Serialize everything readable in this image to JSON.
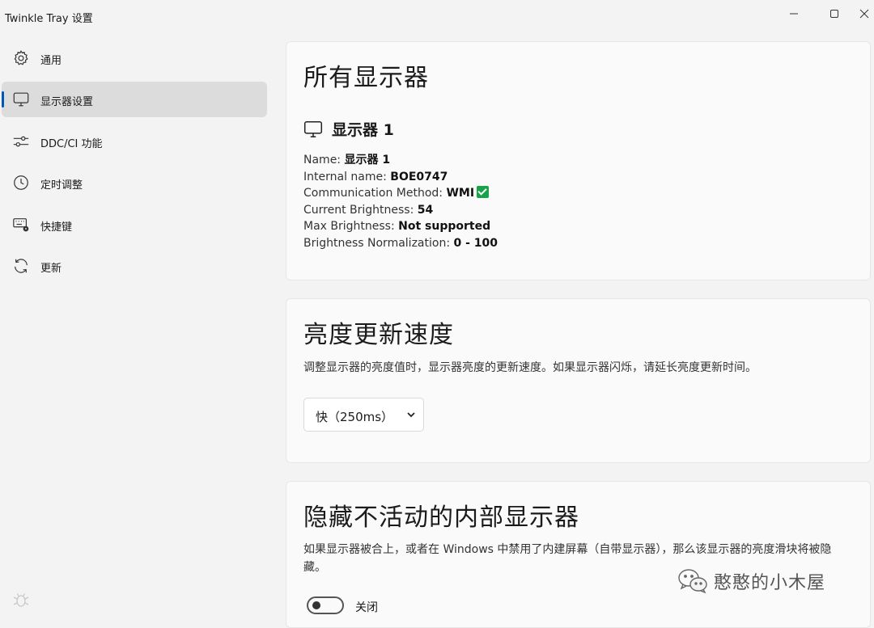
{
  "window": {
    "title": "Twinkle Tray 设置"
  },
  "sidebar": {
    "items": [
      {
        "label": "通用",
        "icon": "gear-icon"
      },
      {
        "label": "显示器设置",
        "icon": "monitor-icon",
        "active": true
      },
      {
        "label": "DDC/CI 功能",
        "icon": "sliders-icon"
      },
      {
        "label": "定时调整",
        "icon": "clock-icon"
      },
      {
        "label": "快捷键",
        "icon": "keyboard-icon"
      },
      {
        "label": "更新",
        "icon": "refresh-icon"
      }
    ],
    "footer_icon": "bug-icon"
  },
  "monitors_card": {
    "title": "所有显示器",
    "monitor": {
      "title": "显示器 1",
      "fields": {
        "name_label": "Name:",
        "name_value": "显示器 1",
        "internal_label": "Internal name:",
        "internal_value": "BOE0747",
        "comm_label": "Communication Method:",
        "comm_value": "WMI",
        "current_label": "Current Brightness:",
        "current_value": "54",
        "max_label": "Max Brightness:",
        "max_value": "Not supported",
        "norm_label": "Brightness Normalization:",
        "norm_value": "0 - 100"
      }
    }
  },
  "update_speed_card": {
    "title": "亮度更新速度",
    "description": "调整显示器的亮度值时，显示器亮度的更新速度。如果显示器闪烁，请延长亮度更新时间。",
    "select_value": "快（250ms）"
  },
  "hide_internal_card": {
    "title": "隐藏不活动的内部显示器",
    "description": "如果显示器被合上，或者在 Windows 中禁用了内建屏幕（自带显示器），那么该显示器的亮度滑块将被隐藏。",
    "toggle_label": "关闭",
    "toggle_on": false
  },
  "watermark": {
    "text": "憨憨的小木屋"
  },
  "colors": {
    "accent": "#0058b5",
    "check": "#16a34a",
    "background": "#f3f3f3",
    "card": "#fafafa"
  }
}
